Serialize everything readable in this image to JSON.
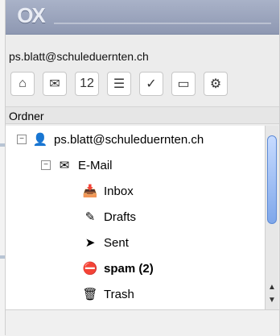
{
  "app": {
    "logo_text": "OX",
    "account": "ps.blatt@schuleduernten.ch"
  },
  "toolbar": {
    "icons": [
      {
        "name": "home-icon",
        "glyph": "⌂"
      },
      {
        "name": "mail-icon",
        "glyph": "✉"
      },
      {
        "name": "calendar-icon",
        "glyph": "12"
      },
      {
        "name": "contacts-icon",
        "glyph": "☰"
      },
      {
        "name": "tasks-icon",
        "glyph": "✓"
      },
      {
        "name": "infostore-icon",
        "glyph": "▭"
      },
      {
        "name": "settings-icon",
        "glyph": "⚙"
      }
    ]
  },
  "sidebar": {
    "section_label": "Ordner",
    "tree": {
      "account_label": "ps.blatt@schuleduernten.ch",
      "email_label": "E-Mail",
      "items": [
        {
          "label": "Inbox",
          "bold": false,
          "icon": "inbox-icon",
          "glyph": "📥"
        },
        {
          "label": "Drafts",
          "bold": false,
          "icon": "drafts-icon",
          "glyph": "✎"
        },
        {
          "label": "Sent",
          "bold": false,
          "icon": "sent-icon",
          "glyph": "➤"
        },
        {
          "label": "spam (2)",
          "bold": true,
          "icon": "spam-icon",
          "glyph": "⛔"
        },
        {
          "label": "Trash",
          "bold": false,
          "icon": "trash-icon",
          "glyph": "🗑"
        }
      ]
    }
  },
  "colors": {
    "header_gradient_top": "#a9b2c8",
    "header_gradient_bottom": "#8e98b2",
    "scroll_thumb": "#7fa7ea"
  }
}
